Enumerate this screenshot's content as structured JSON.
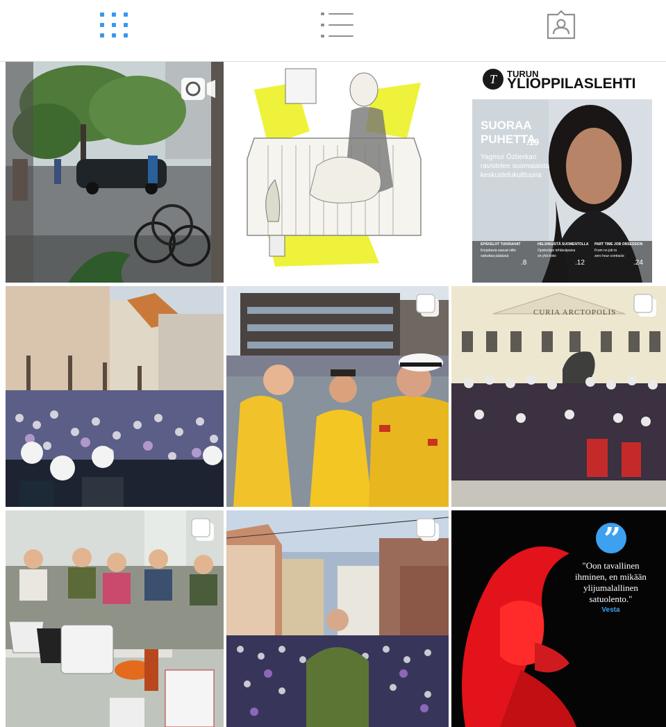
{
  "tabs": [
    {
      "name": "grid",
      "icon": "grid-icon",
      "active": true,
      "color": "#3897f0"
    },
    {
      "name": "list",
      "icon": "list-icon",
      "active": false,
      "color": "#8e8e8e"
    },
    {
      "name": "tagged",
      "icon": "tagged-user-icon",
      "active": false,
      "color": "#8e8e8e"
    }
  ],
  "posts": [
    {
      "id": 1,
      "type": "video",
      "badge": "video-icon"
    },
    {
      "id": 2,
      "type": "image"
    },
    {
      "id": 3,
      "type": "image",
      "magazine": {
        "masthead_small": "TURUN",
        "masthead": "YLIOPPILASLEHTI",
        "headline_1": "SUORAA",
        "headline_2": "PUHETTA",
        "page": ".19",
        "teaser_1": "Yagmur Özberkan",
        "teaser_2": "ravistelee suomalaista",
        "teaser_3": "keskustelukulttuuria",
        "footer_1_title": "EPÄKELOT TUKIRAHAT",
        "footer_1_text": "Korjattavia saavat niille",
        "footer_1_sub": "vaikuttaa pääässä",
        "footer_1_page": ".8",
        "footer_2_title": "HELSINGISTÄ SUOMENTOLLA",
        "footer_2_text": "Opiskelijan tehtäväpaiva",
        "footer_2_sub": "on yhä koko",
        "footer_2_page": ".12",
        "footer_3_title": "PART TIME JOB OBSESSION",
        "footer_3_text": "From no job to",
        "footer_3_sub": "zero hour contracts",
        "footer_3_page": ".24"
      }
    },
    {
      "id": 4,
      "type": "image"
    },
    {
      "id": 5,
      "type": "carousel",
      "badge": "carousel-icon"
    },
    {
      "id": 6,
      "type": "carousel",
      "badge": "carousel-icon",
      "building_text": "CURIA ARCTOPOLIS"
    },
    {
      "id": 7,
      "type": "carousel",
      "badge": "carousel-icon"
    },
    {
      "id": 8,
      "type": "carousel",
      "badge": "carousel-icon"
    },
    {
      "id": 9,
      "type": "image",
      "quote": {
        "mark": "”",
        "line_1": "\"Oon tavallinen",
        "line_2": "ihminen, en mikään",
        "line_3": "ylijumalallinen",
        "line_4": "satuolento.\"",
        "author": "Vesta",
        "mark_color": "#3ea1ef",
        "author_color": "#3ea1ef"
      }
    }
  ]
}
